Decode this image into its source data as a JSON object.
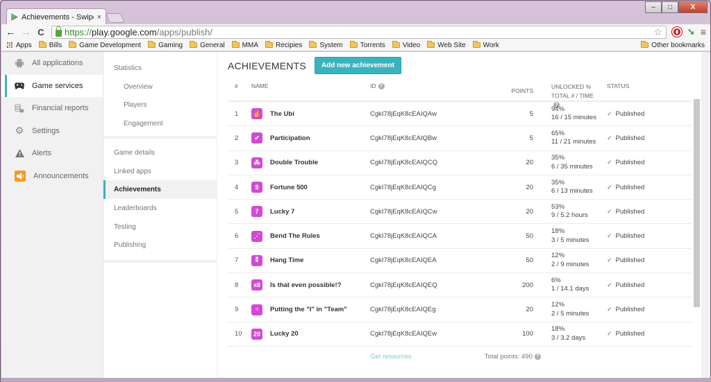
{
  "browser": {
    "tab_title": "Achievements - Swipe Tap",
    "tab_close": "×",
    "window_controls": {
      "minimize": "–",
      "maximize": "□",
      "close": "X"
    },
    "nav": {
      "back": "←",
      "forward": "→",
      "reload": "C"
    },
    "url": {
      "scheme": "https://",
      "host": "play.google.com",
      "path": "/apps/publish/"
    },
    "star": "☆",
    "ext_arrow": "➘",
    "menu": "≡",
    "bookmarks": [
      "Apps",
      "Bills",
      "Game Development",
      "Gaming",
      "General",
      "MMA",
      "Recipies",
      "System",
      "Torrents",
      "Video",
      "Web Site",
      "Work"
    ],
    "other_bookmarks": "Other bookmarks"
  },
  "leftnav": {
    "items": [
      {
        "label": "All applications",
        "icon": "android-icon",
        "glyph": "🤖"
      },
      {
        "label": "Game services",
        "icon": "gamepad-icon",
        "glyph": "🎮",
        "active": true
      },
      {
        "label": "Financial reports",
        "icon": "coins-icon",
        "glyph": "≋"
      },
      {
        "label": "Settings",
        "icon": "gear-icon",
        "glyph": "⚙"
      },
      {
        "label": "Alerts",
        "icon": "warning-icon",
        "glyph": "▲"
      },
      {
        "label": "Announcements",
        "icon": "megaphone-icon",
        "glyph": "◖"
      }
    ]
  },
  "subnav": {
    "statistics": {
      "label": "Statistics",
      "children": [
        "Overview",
        "Players",
        "Engagement"
      ]
    },
    "items": [
      "Game details",
      "Linked apps",
      "Achievements",
      "Leaderboards",
      "Testing",
      "Publishing"
    ],
    "active": "Achievements"
  },
  "main": {
    "title": "ACHIEVEMENTS",
    "add_button": "Add new achievement",
    "columns": {
      "num": "#",
      "name": "NAME",
      "id": "ID",
      "points": "POINTS",
      "unlocked_line1": "UNLOCKED %",
      "unlocked_line2": "TOTAL # / TIME",
      "status": "STATUS"
    },
    "help_glyph": "?",
    "check_glyph": "✓",
    "rows": [
      {
        "num": "1",
        "name": "The Ubi",
        "icon": "pointing-hand-icon",
        "glyph": "☝",
        "id": "CgkI78jEqK8cEAIQAw",
        "points": "5",
        "unlocked_pct": "94%",
        "total_time": "16 / 15 minutes",
        "status": "Published"
      },
      {
        "num": "2",
        "name": "Participation",
        "icon": "checkbox-icon",
        "glyph": "✔",
        "id": "CgkI78jEqK8cEAIQBw",
        "points": "5",
        "unlocked_pct": "65%",
        "total_time": "11 / 21 minutes",
        "status": "Published"
      },
      {
        "num": "3",
        "name": "Double Trouble",
        "icon": "double-trouble-icon",
        "glyph": "⁂",
        "id": "CgkI78jEqK8cEAIQCQ",
        "points": "20",
        "unlocked_pct": "35%",
        "total_time": "6 / 35 minutes",
        "status": "Published"
      },
      {
        "num": "4",
        "name": "Fortune 500",
        "icon": "fortune-icon",
        "glyph": "$",
        "id": "CgkI78jEqK8cEAIQCg",
        "points": "20",
        "unlocked_pct": "35%",
        "total_time": "6 / 13 minutes",
        "status": "Published"
      },
      {
        "num": "5",
        "name": "Lucky 7",
        "icon": "lucky-seven-icon",
        "glyph": "7",
        "id": "CgkI78jEqK8cEAIQCw",
        "points": "20",
        "unlocked_pct": "53%",
        "total_time": "9 / 5.2 hours",
        "status": "Published"
      },
      {
        "num": "6",
        "name": "Bend The Rules",
        "icon": "bend-rules-icon",
        "glyph": "⋰",
        "id": "CgkI78jEqK8cEAIQCA",
        "points": "50",
        "unlocked_pct": "18%",
        "total_time": "3 / 5 minutes",
        "status": "Published"
      },
      {
        "num": "7",
        "name": "Hang Time",
        "icon": "hang-time-icon",
        "glyph": "⁑",
        "id": "CgkI78jEqK8cEAIQEA",
        "points": "50",
        "unlocked_pct": "12%",
        "total_time": "2 / 9 minutes",
        "status": "Published"
      },
      {
        "num": "8",
        "name": "Is that even possible!?",
        "icon": "x8-icon",
        "glyph": "x8",
        "id": "CgkI78jEqK8cEAIQEQ",
        "points": "200",
        "unlocked_pct": "6%",
        "total_time": "1 / 14.1 days",
        "status": "Published"
      },
      {
        "num": "9",
        "name": "Putting the \"I\" in \"Team\"",
        "icon": "team-icon",
        "glyph": "⁖",
        "id": "CgkI78jEqK8cEAIQEg",
        "points": "20",
        "unlocked_pct": "12%",
        "total_time": "2 / 5 minutes",
        "status": "Published"
      },
      {
        "num": "10",
        "name": "Lucky 20",
        "icon": "lucky-twenty-icon",
        "glyph": "20",
        "id": "CgkI78jEqK8cEAIQEw",
        "points": "100",
        "unlocked_pct": "18%",
        "total_time": "3 / 3.2 days",
        "status": "Published"
      }
    ],
    "footer": {
      "get_resources": "Get resources",
      "total_points": "Total points: 490"
    }
  },
  "colors": {
    "accent": "#3bb3be",
    "achievement_icon_bg": "#d24ad4",
    "link": "#7dc9d2"
  }
}
